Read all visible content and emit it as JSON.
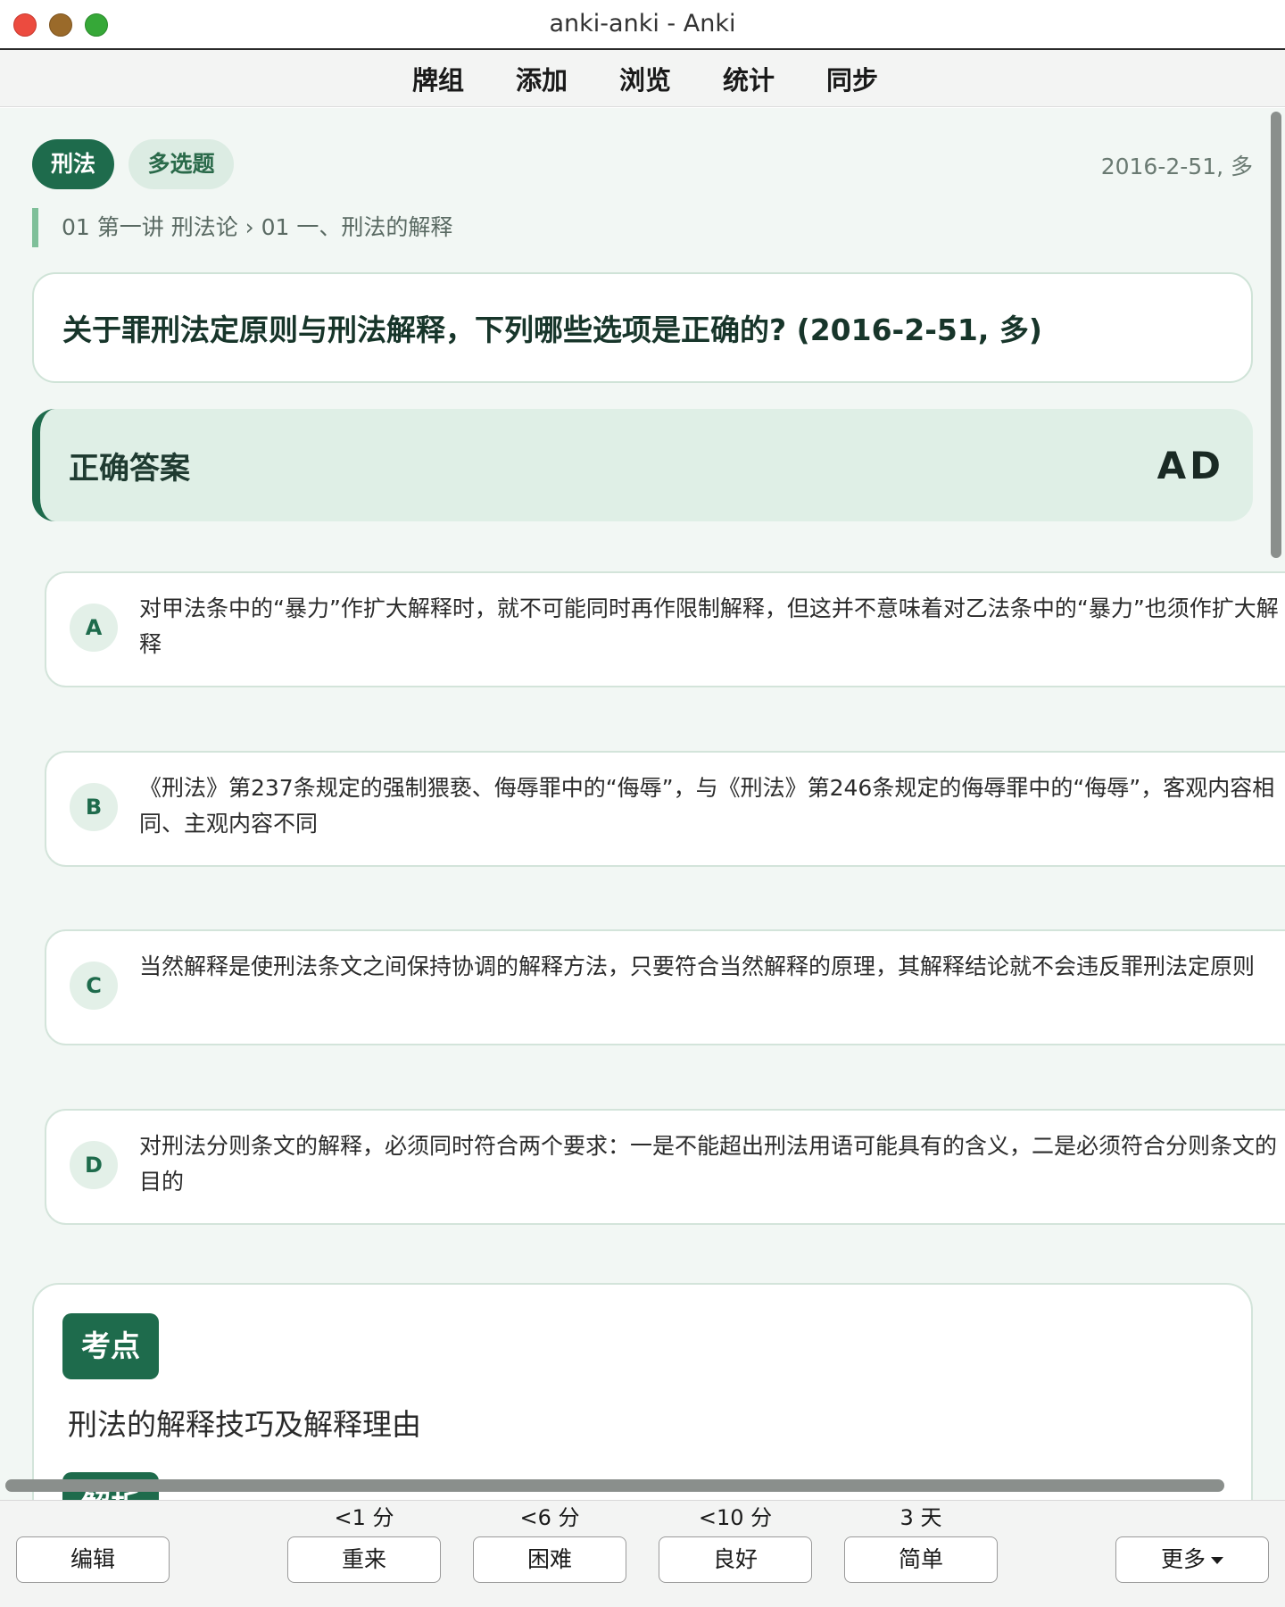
{
  "window": {
    "title": "anki-anki - Anki"
  },
  "nav": {
    "items": [
      "牌组",
      "添加",
      "浏览",
      "统计",
      "同步"
    ]
  },
  "card": {
    "tags": {
      "subject": "刑法",
      "type": "多选题"
    },
    "meta": "2016-2-51, 多",
    "breadcrumb": "01 第一讲 刑法论 › 01 一、刑法的解释",
    "question": "关于罪刑法定原则与刑法解释，下列哪些选项是正确的? (2016-2-51, 多)",
    "answer": {
      "label": "正确答案",
      "value": "AD"
    },
    "options": [
      {
        "letter": "A",
        "text": "对甲法条中的“暴力”作扩大解释时，就不可能同时再作限制解释，但这并不意味着对乙法条中的“暴力”也须作扩大解释"
      },
      {
        "letter": "B",
        "text": "《刑法》第237条规定的强制猥亵、侮辱罪中的“侮辱”，与《刑法》第246条规定的侮辱罪中的“侮辱”，客观内容相同、主观内容不同"
      },
      {
        "letter": "C",
        "text": "当然解释是使刑法条文之间保持协调的解释方法，只要符合当然解释的原理，其解释结论就不会违反罪刑法定原则"
      },
      {
        "letter": "D",
        "text": "对刑法分则条文的解释，必须同时符合两个要求：一是不能超出刑法用语可能具有的含义，二是必须符合分则条文的目的"
      }
    ],
    "key_point": {
      "badge": "考点",
      "text": "刑法的解释技巧及解释理由",
      "analysis_badge": "解析"
    }
  },
  "bottom": {
    "edit_label": "编辑",
    "more_label": "更多",
    "answers": [
      {
        "interval": "<1 分",
        "label": "重来"
      },
      {
        "interval": "<6 分",
        "label": "困难"
      },
      {
        "interval": "<10 分",
        "label": "良好"
      },
      {
        "interval": "3 天",
        "label": "简单"
      }
    ]
  },
  "colors": {
    "accent": "#1e6b4c",
    "accent_light": "#dfefe6",
    "background": "#f2f7f4"
  }
}
